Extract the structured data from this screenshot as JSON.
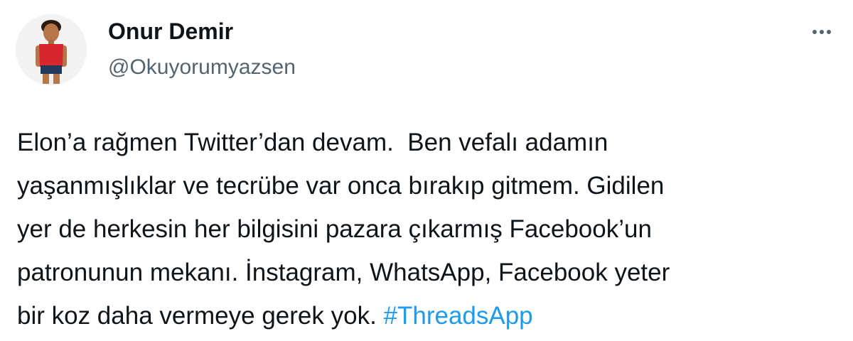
{
  "author": {
    "display_name": "Onur Demir",
    "handle": "@Okuyorumyazsen"
  },
  "more_icon": "more-horizontal-icon",
  "tweet": {
    "lines": [
      "Elon’a rağmen Twitter’dan devam.  Ben vefalı adamın",
      "yaşanmışlıklar ve tecrübe var onca bırakıp gitmem. Gidilen",
      "yer de herkesin her bilgisini pazara çıkarmış Facebook’un",
      "patronunun mekanı. İnstagram, WhatsApp, Facebook yeter",
      "bir koz daha vermeye gerek yok. "
    ],
    "hashtag": "#ThreadsApp"
  },
  "colors": {
    "text": "#0f1419",
    "secondary": "#536471",
    "link": "#1d9bf0"
  }
}
